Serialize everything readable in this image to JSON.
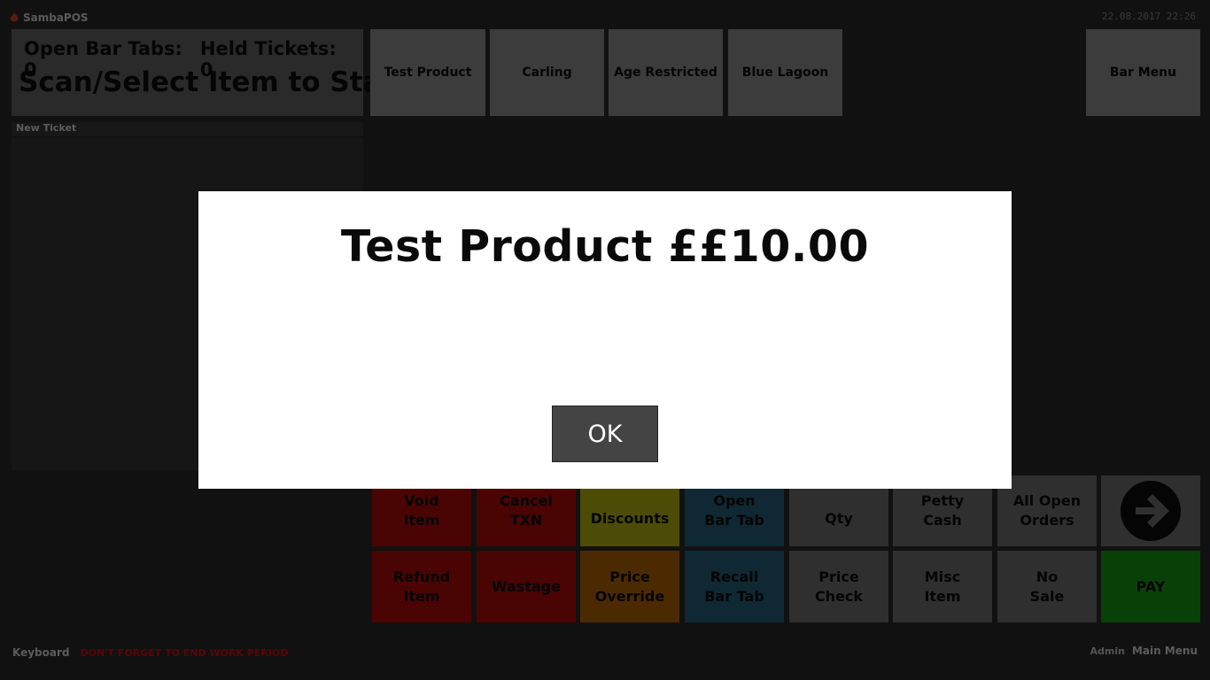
{
  "header": {
    "app_name": "SambaPOS",
    "datetime": "22.08.2017 22:26"
  },
  "info": {
    "open_bar_tabs": "Open Bar Tabs: 0",
    "held_tickets": "Held Tickets: 0",
    "prompt": "Scan/Select Item to Start"
  },
  "ticket": {
    "label": "New Ticket"
  },
  "quick_buttons": [
    "Test Product",
    "Carling",
    "Age Restricted",
    "Blue Lagoon"
  ],
  "menu_button": "Bar Menu",
  "actions": {
    "void_item": "Void\nItem",
    "cancel_txn": "Cancel\nTXN",
    "discounts": "Discounts",
    "open_bar_tab": "Open\nBar Tab",
    "qty": "Qty",
    "petty_cash": "Petty\nCash",
    "all_open_orders": "All Open\nOrders",
    "refund_item": "Refund\nItem",
    "wastage": "Wastage",
    "price_override": "Price\nOverride",
    "recall_bar_tab": "Recall\nBar Tab",
    "price_check": "Price\nCheck",
    "misc_item": "Misc\nItem",
    "no_sale": "No\nSale",
    "pay": "PAY"
  },
  "footer": {
    "keyboard": "Keyboard",
    "warning": "DON'T FORGET TO END WORK PERIOD",
    "user": "Admin",
    "main_menu": "Main Menu"
  },
  "modal": {
    "message": "Test Product ££10.00",
    "ok_label": "OK"
  },
  "colors": {
    "red": "#4a0404",
    "yellow": "#4d4c06",
    "orange": "#4b2a02",
    "blue": "#102833",
    "grey": "#2f2f2f",
    "green": "#084108",
    "modal_bg": "#ffffff",
    "ok_button": "#444444"
  },
  "icons": {
    "logo": "flame-icon",
    "next": "arrow-right-circle-icon"
  }
}
